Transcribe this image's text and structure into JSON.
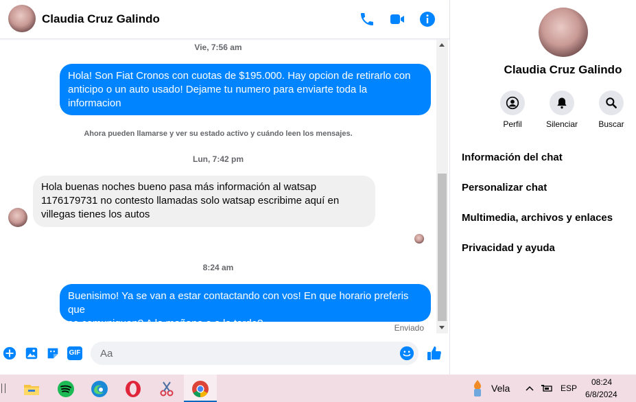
{
  "header": {
    "name": "Claudia Cruz Galindo"
  },
  "icons": {
    "phone": "phone-icon",
    "video": "video-icon",
    "info": "info-icon"
  },
  "colors": {
    "accent": "#0084ff",
    "incoming_bg": "#f0f0f0"
  },
  "messages": {
    "t1": "Vie, 7:56 am",
    "m1_lines": [
      "Hola! Son Fiat Cronos con cuotas de $195.000. Hay opcion de retirarlo con",
      "anticipo o un auto usado! Dejame tu numero para enviarte toda la",
      "informacion"
    ],
    "notice": "Ahora pueden llamarse y ver su estado activo y cuándo leen los mensajes.",
    "t2": "Lun, 7:42 pm",
    "m2_lines": [
      "Hola buenas noches bueno pasa más información al watsap",
      "1176179731 no contesto llamadas solo watsap escribime aquí en",
      "villegas tienes los autos"
    ],
    "t3": "8:24 am",
    "m3_lines": [
      "Buenisimo! Ya se van a estar contactando con vos! En que horario preferis que",
      "se comuniquen? A la mañana o a la tarde?"
    ],
    "status": "Enviado"
  },
  "composer": {
    "placeholder": "Aa",
    "gif_label": "GIF"
  },
  "sidebar": {
    "name": "Claudia Cruz Galindo",
    "actions": [
      {
        "label": "Perfil",
        "icon": "profile-icon"
      },
      {
        "label": "Silenciar",
        "icon": "bell-icon"
      },
      {
        "label": "Buscar",
        "icon": "search-icon"
      }
    ],
    "menu": [
      "Información del chat",
      "Personalizar chat",
      "Multimedia, archivos y enlaces",
      "Privacidad y ayuda"
    ]
  },
  "taskbar": {
    "weather": "Vela",
    "lang": "ESP",
    "time": "08:24",
    "date": "6/8/2024"
  }
}
